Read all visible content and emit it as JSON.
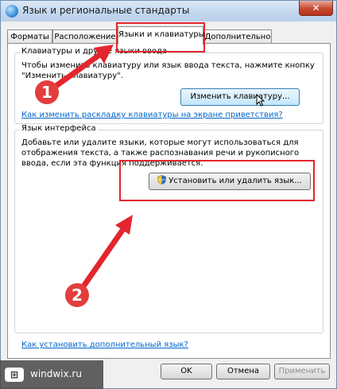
{
  "window": {
    "title": "Язык и региональные стандарты",
    "close_label": "✕"
  },
  "tabs": [
    {
      "label": "Форматы",
      "active": false
    },
    {
      "label": "Расположение",
      "active": false
    },
    {
      "label": "Языки и клавиатуры",
      "active": true
    },
    {
      "label": "Дополнительно",
      "active": false
    }
  ],
  "keyboards": {
    "title": "Клавиатуры и другие языки ввода",
    "desc_line1": "Чтобы изменить клавиатуру или язык ввода текста, нажмите кнопку",
    "desc_line2": "\"Изменить клавиатуру\".",
    "change_button": "Изменить клавиатуру...",
    "welcome_link": "Как изменить раскладку клавиатуры на экране приветствия?"
  },
  "display_language": {
    "title": "Язык интерфейса",
    "desc_line1": "Добавьте или удалите языки, которые могут использоваться для",
    "desc_line2": "отображения текста, а также распознавания речи и рукописного",
    "desc_line3": "ввода, если эта функция поддерживается.",
    "install_button": "Установить или удалить язык..."
  },
  "footer_link": "Как установить дополнительный язык?",
  "buttons": {
    "ok": "OK",
    "cancel": "Отмена",
    "apply": "Применить"
  },
  "annotations": {
    "step1": "1",
    "step2": "2",
    "accent_color": "#e3262d"
  },
  "watermark": {
    "logo": "⊞",
    "text": "windwix.ru"
  }
}
